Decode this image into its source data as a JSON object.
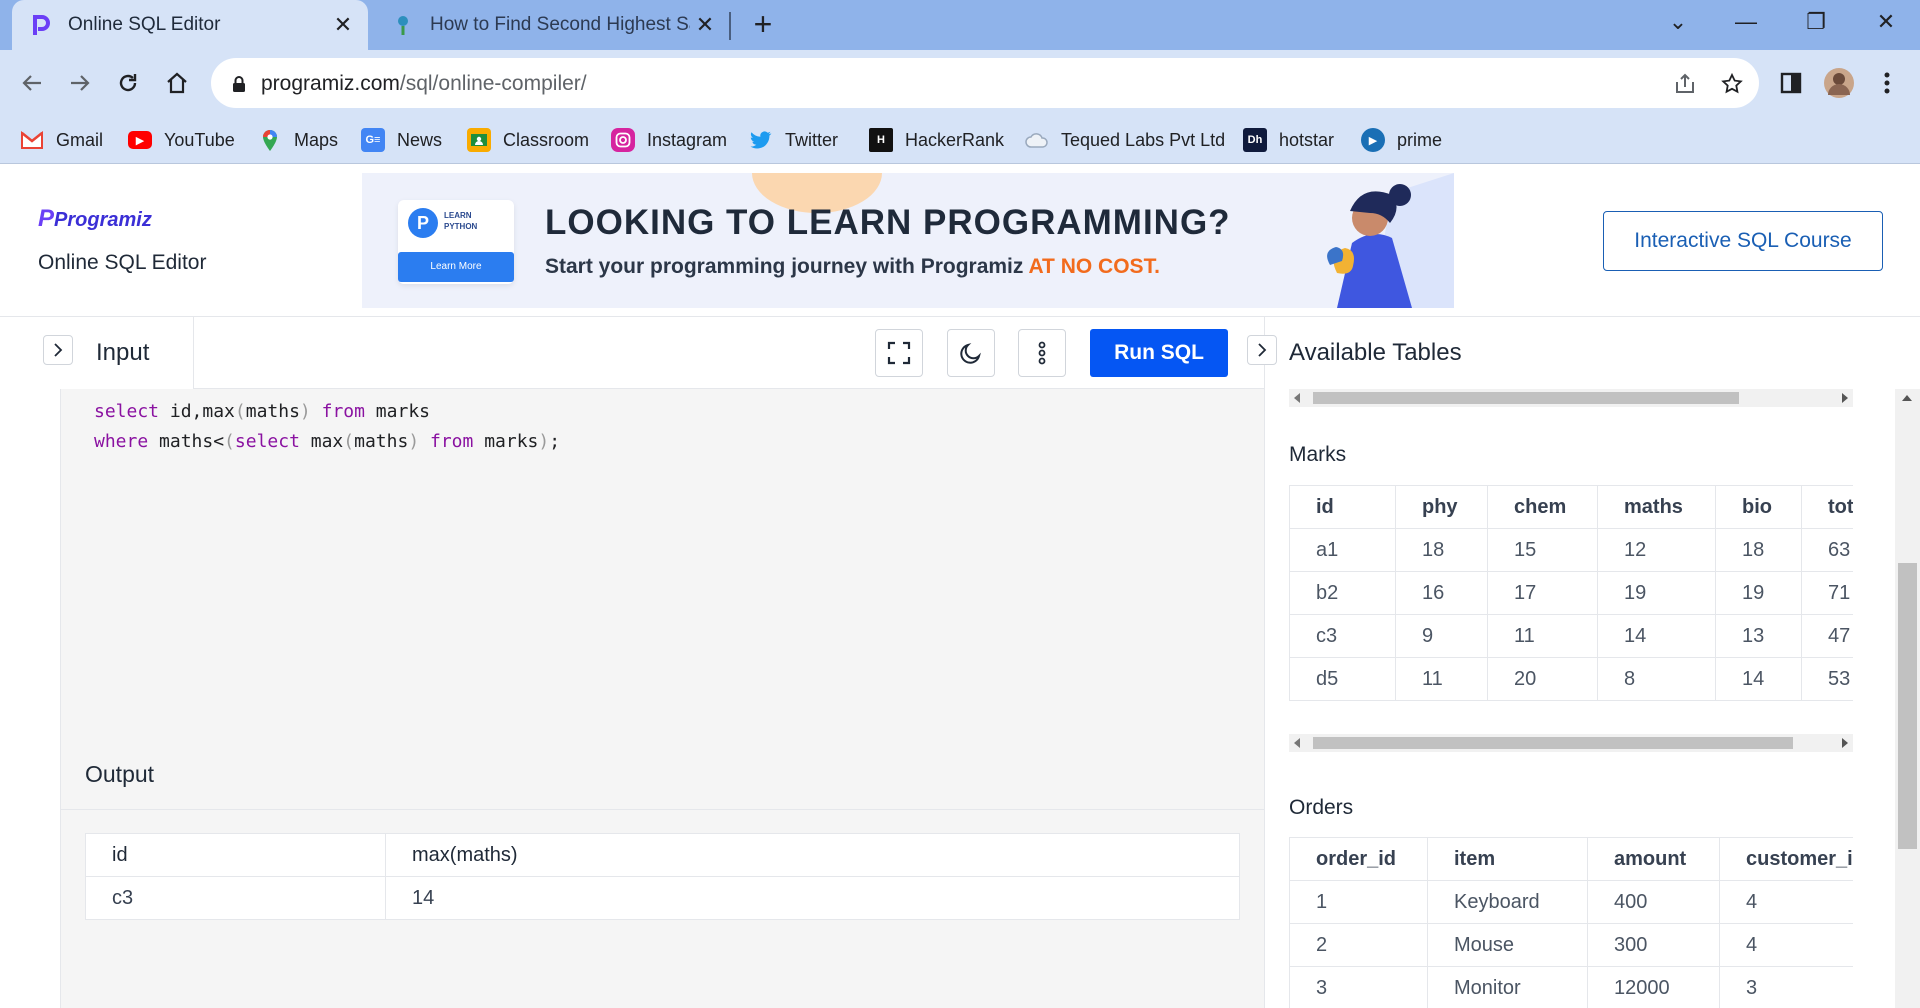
{
  "browser": {
    "tabs": [
      {
        "title": "Online SQL Editor",
        "active": true
      },
      {
        "title": "How to Find Second Highest Sala",
        "active": false
      }
    ],
    "new_tab": "+",
    "window_controls": {
      "minimize": "—",
      "restore": "❐",
      "close": "✕",
      "tab_search": "⌄"
    },
    "url_host": "programiz.com",
    "url_path": "/sql/online-compiler/",
    "bookmarks": [
      {
        "label": "Gmail",
        "icon": "gmail-icon",
        "color": "#ea4335"
      },
      {
        "label": "YouTube",
        "icon": "youtube-icon",
        "color": "#ff0000"
      },
      {
        "label": "Maps",
        "icon": "maps-icon",
        "color": "#34a853"
      },
      {
        "label": "News",
        "icon": "news-icon",
        "color": "#4285f4"
      },
      {
        "label": "Classroom",
        "icon": "classroom-icon",
        "color": "#f9ab00"
      },
      {
        "label": "Instagram",
        "icon": "instagram-icon",
        "color": "#d6249f"
      },
      {
        "label": "Twitter",
        "icon": "twitter-icon",
        "color": "#1d9bf0"
      },
      {
        "label": "HackerRank",
        "icon": "hackerrank-icon",
        "color": "#111111"
      },
      {
        "label": "Tequed Labs Pvt Ltd",
        "icon": "cloud-icon",
        "color": "#9aa9bd"
      },
      {
        "label": "hotstar",
        "icon": "hotstar-icon",
        "color": "#0f1a3c"
      },
      {
        "label": "prime",
        "icon": "prime-icon",
        "color": "#1a6fb5"
      }
    ]
  },
  "site": {
    "logo": "Programiz",
    "subtitle": "Online SQL Editor",
    "banner": {
      "badge_line1": "LEARN",
      "badge_line2": "PYTHON",
      "badge_button": "Learn More",
      "headline": "LOOKING TO LEARN PROGRAMMING?",
      "subline": "Start your programming journey with Programiz ",
      "subline_highlight": "AT NO COST."
    },
    "course_button": "Interactive SQL Course"
  },
  "editor": {
    "input_title": "Input",
    "run_button": "Run SQL",
    "code_lines": [
      [
        [
          "kw",
          "select"
        ],
        [
          "tx",
          " id,max"
        ],
        [
          "pn",
          "("
        ],
        [
          "tx",
          "maths"
        ],
        [
          "pn",
          ")"
        ],
        [
          "tx",
          " "
        ],
        [
          "kw",
          "from"
        ],
        [
          "tx",
          " marks"
        ]
      ],
      [
        [
          "kw",
          "where"
        ],
        [
          "tx",
          " maths<"
        ],
        [
          "pn",
          "("
        ],
        [
          "kw",
          "select"
        ],
        [
          "tx",
          " max"
        ],
        [
          "pn",
          "("
        ],
        [
          "tx",
          "maths"
        ],
        [
          "pn",
          ")"
        ],
        [
          "tx",
          " "
        ],
        [
          "kw",
          "from"
        ],
        [
          "tx",
          " marks"
        ],
        [
          "pn",
          ")"
        ],
        [
          "tx",
          ";"
        ]
      ]
    ],
    "output_title": "Output",
    "output_table": {
      "columns": [
        "id",
        "max(maths)"
      ],
      "rows": [
        [
          "c3",
          "14"
        ]
      ]
    }
  },
  "tables_panel": {
    "title": "Available Tables",
    "marks": {
      "label": "Marks",
      "columns": [
        "id",
        "phy",
        "chem",
        "maths",
        "bio",
        "totalScore"
      ],
      "rows": [
        [
          "a1",
          "18",
          "15",
          "12",
          "18",
          "63"
        ],
        [
          "b2",
          "16",
          "17",
          "19",
          "19",
          "71"
        ],
        [
          "c3",
          "9",
          "11",
          "14",
          "13",
          "47"
        ],
        [
          "d5",
          "11",
          "20",
          "8",
          "14",
          "53"
        ]
      ]
    },
    "orders": {
      "label": "Orders",
      "columns": [
        "order_id",
        "item",
        "amount",
        "customer_id"
      ],
      "rows": [
        [
          "1",
          "Keyboard",
          "400",
          "4"
        ],
        [
          "2",
          "Mouse",
          "300",
          "4"
        ],
        [
          "3",
          "Monitor",
          "12000",
          "3"
        ]
      ]
    }
  }
}
